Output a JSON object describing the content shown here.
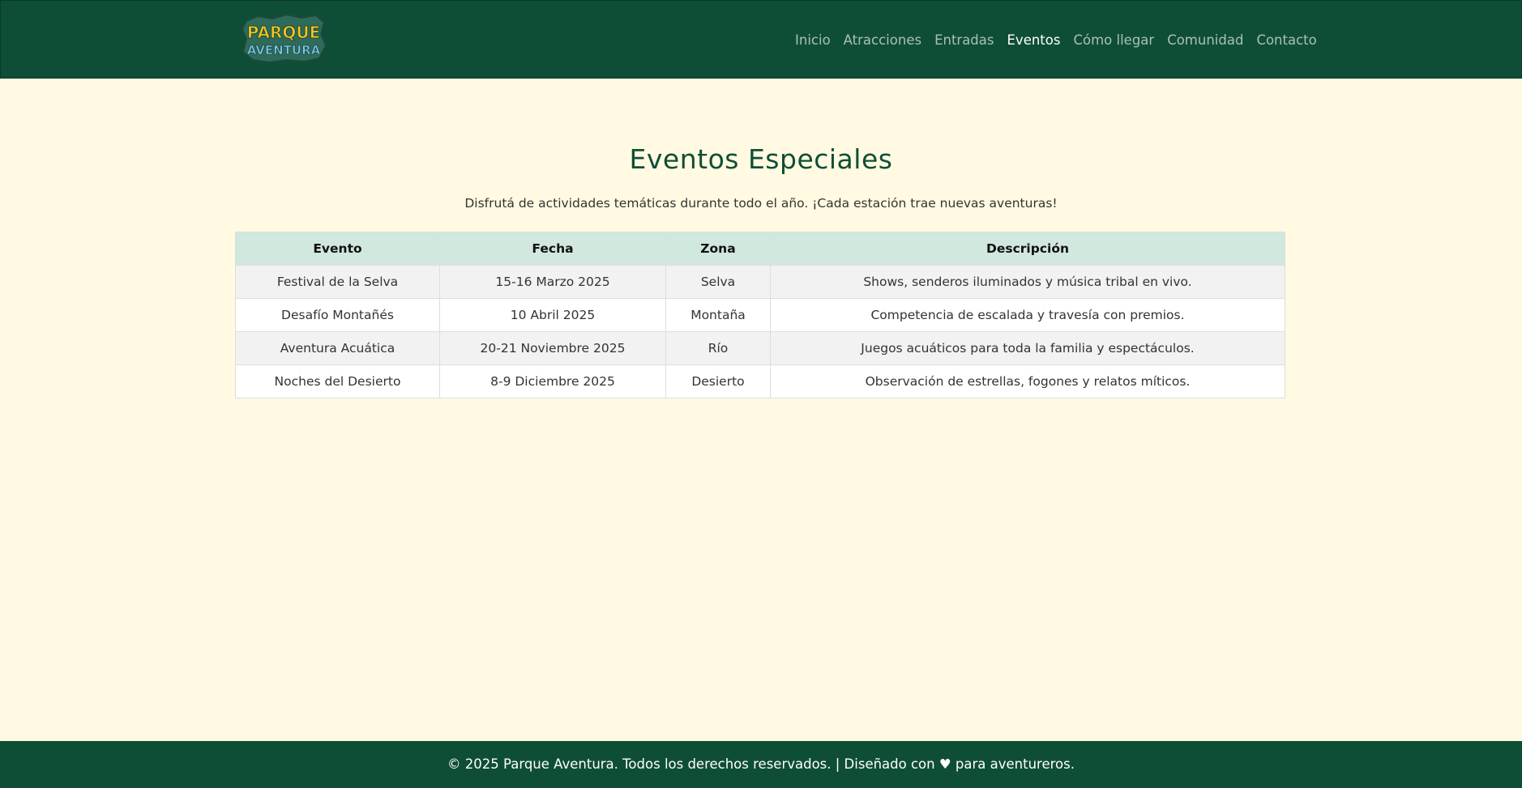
{
  "brand": {
    "logo_line1": "PARQUE",
    "logo_line2": "AVENTURA",
    "colors": {
      "header_bg": "#0f4e36",
      "page_bg": "#fffae1",
      "table_header_bg": "#d1e8df",
      "logo_yellow": "#f5c518",
      "logo_blue": "#7ec8f0"
    }
  },
  "nav": {
    "items": [
      {
        "label": "Inicio",
        "active": false
      },
      {
        "label": "Atracciones",
        "active": false
      },
      {
        "label": "Entradas",
        "active": false
      },
      {
        "label": "Eventos",
        "active": true
      },
      {
        "label": "Cómo llegar",
        "active": false
      },
      {
        "label": "Comunidad",
        "active": false
      },
      {
        "label": "Contacto",
        "active": false
      }
    ]
  },
  "main": {
    "title": "Eventos Especiales",
    "intro": "Disfrutá de actividades temáticas durante todo el año. ¡Cada estación trae nuevas aventuras!",
    "table": {
      "headers": [
        "Evento",
        "Fecha",
        "Zona",
        "Descripción"
      ],
      "rows": [
        [
          "Festival de la Selva",
          "15-16 Marzo 2025",
          "Selva",
          "Shows, senderos iluminados y música tribal en vivo."
        ],
        [
          "Desafío Montañés",
          "10 Abril 2025",
          "Montaña",
          "Competencia de escalada y travesía con premios."
        ],
        [
          "Aventura Acuática",
          "20-21 Noviembre 2025",
          "Río",
          "Juegos acuáticos para toda la familia y espectáculos."
        ],
        [
          "Noches del Desierto",
          "8-9 Diciembre 2025",
          "Desierto",
          "Observación de estrellas, fogones y relatos míticos."
        ]
      ]
    }
  },
  "footer": {
    "text": "© 2025 Parque Aventura. Todos los derechos reservados. | Diseñado con ♥ para aventureros."
  }
}
